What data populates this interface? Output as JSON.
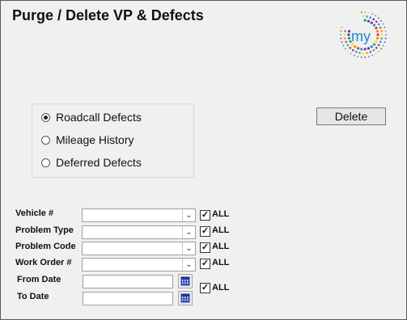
{
  "title": "Purge / Delete VP & Defects",
  "logo_text": "my",
  "options": [
    {
      "label": "Roadcall Defects",
      "selected": true
    },
    {
      "label": "Mileage History",
      "selected": false
    },
    {
      "label": "Deferred Defects",
      "selected": false
    }
  ],
  "delete_label": "Delete",
  "fields": {
    "vehicle": {
      "label": "Vehicle #",
      "value": "",
      "all_label": "ALL",
      "all_checked": true
    },
    "problem_type": {
      "label": "Problem Type",
      "value": "",
      "all_label": "ALL",
      "all_checked": true
    },
    "problem_code": {
      "label": "Problem Code",
      "value": "",
      "all_label": "ALL",
      "all_checked": true
    },
    "work_order": {
      "label": "Work Order #",
      "value": "",
      "all_label": "ALL",
      "all_checked": true
    }
  },
  "dates": {
    "from_label": "From Date",
    "from_value": "",
    "to_label": "To Date",
    "to_value": "",
    "all_label": "ALL",
    "all_checked": true
  },
  "check_mark": "✓",
  "icons": {
    "dropdown": "chevron-down-icon",
    "calendar": "calendar-icon"
  },
  "colors": {
    "window_bg": "#f0f0f0",
    "calendar_icon": "#2f4fb0"
  }
}
